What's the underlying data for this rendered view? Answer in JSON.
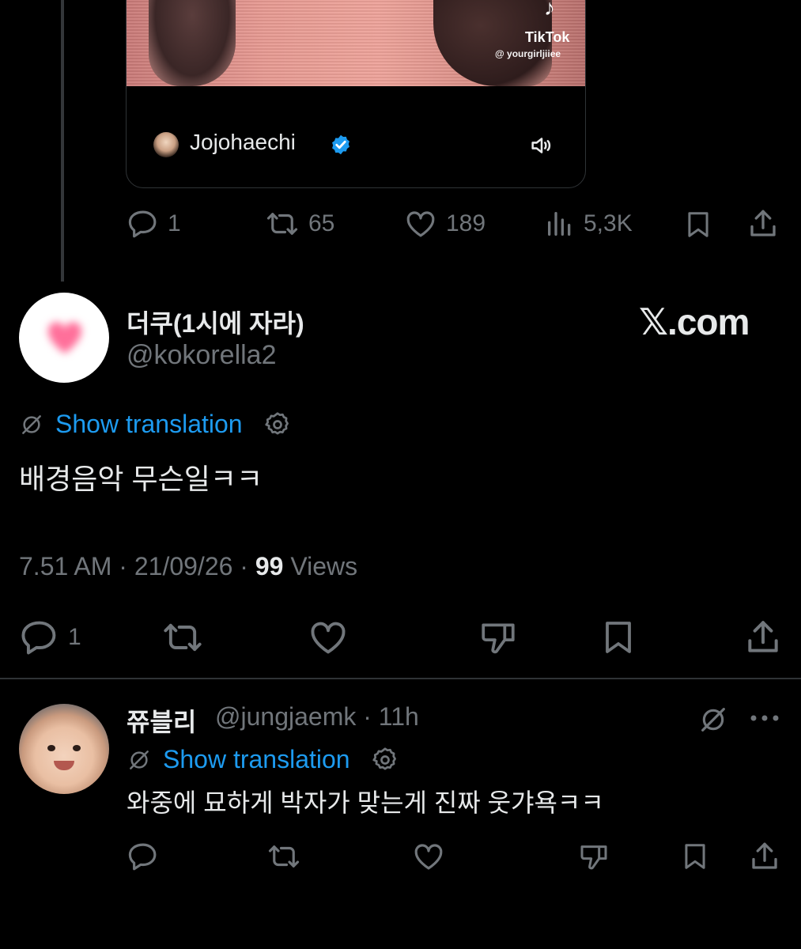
{
  "quoted_tweet": {
    "video_watermark_brand": "TikTok",
    "video_watermark_handle": "@ yourgirljiiee",
    "author_name": "Jojohaechi",
    "actions": {
      "replies": "1",
      "reposts": "65",
      "likes": "189",
      "views": "5,3K"
    }
  },
  "main_tweet": {
    "display_name": "더쿠(1시에 자라)",
    "handle": "@kokorella2",
    "brand_mark": "𝕏.com",
    "show_translation": "Show translation",
    "text": "배경음악 무슨일ㅋㅋ",
    "time": "7.51 AM · 21/09/26 · ",
    "views_count": "99",
    "views_label": " Views",
    "replies": "1"
  },
  "reply_tweet": {
    "display_name": "쮸블리",
    "handle_time": "@jungjaemk · 11h",
    "show_translation": "Show translation",
    "text": "와중에 묘하게 박자가 맞는게 진짜 웃갸욕ㅋㅋ"
  },
  "colors": {
    "background": "#000000",
    "text": "#e7e9ea",
    "muted": "#71767b",
    "accent": "#1d9bf0"
  }
}
